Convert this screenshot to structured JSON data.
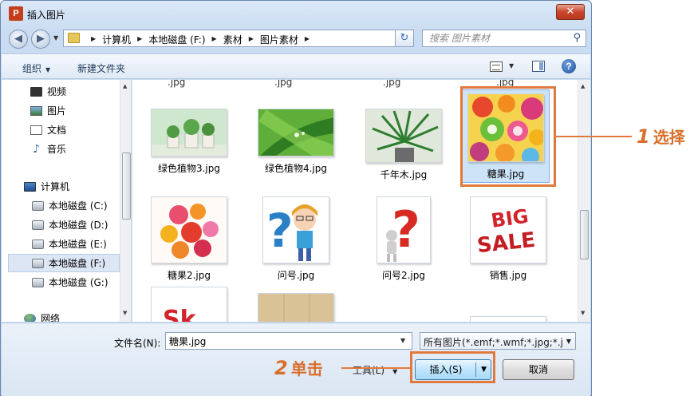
{
  "window": {
    "title": "插入图片",
    "app_icon": "P",
    "close_glyph": "✕"
  },
  "address": {
    "crumbs": [
      "计算机",
      "本地磁盘 (F:)",
      "素材",
      "图片素材"
    ],
    "search_placeholder": "搜索 图片素材"
  },
  "toolbar": {
    "organize_label": "组织",
    "new_folder_label": "新建文件夹"
  },
  "nav": {
    "items": [
      {
        "label": "视频",
        "icon": "video-icon"
      },
      {
        "label": "图片",
        "icon": "pictures-icon"
      },
      {
        "label": "文档",
        "icon": "documents-icon"
      },
      {
        "label": "音乐",
        "icon": "music-icon"
      },
      {
        "label": "计算机",
        "icon": "computer-icon"
      },
      {
        "label": "本地磁盘 (C:)",
        "icon": "drive-icon"
      },
      {
        "label": "本地磁盘 (D:)",
        "icon": "drive-icon"
      },
      {
        "label": "本地磁盘 (E:)",
        "icon": "drive-icon"
      },
      {
        "label": "本地磁盘 (F:)",
        "icon": "drive-icon",
        "selected": true
      },
      {
        "label": "本地磁盘 (G:)",
        "icon": "drive-icon"
      },
      {
        "label": "网络",
        "icon": "network-icon"
      }
    ]
  },
  "files": {
    "row1": [
      {
        "name": "绿色植物3.jpg"
      },
      {
        "name": "绿色植物4.jpg"
      },
      {
        "name": "千年木.jpg"
      },
      {
        "name": "糖果.jpg",
        "selected": true
      }
    ],
    "row2": [
      {
        "name": "糖果2.jpg"
      },
      {
        "name": "问号.jpg"
      },
      {
        "name": "问号2.jpg"
      },
      {
        "name": "销售.jpg"
      }
    ],
    "row3_partial": [
      {
        "name": "",
        "thumbnail_text": "Sk"
      }
    ],
    "cut_labels": [
      ".jpg",
      ".jpg",
      ".jpg",
      ".jpg"
    ]
  },
  "bottom": {
    "filename_label": "文件名(N):",
    "filename_value": "糖果.jpg",
    "filter_value": "所有图片(*.emf;*.wmf;*.jpg;*.j",
    "tools_label": "工具(L)",
    "insert_label": "插入(S)",
    "cancel_label": "取消"
  },
  "annotations": {
    "step1_num": "1",
    "step1_text": "选择",
    "step2_num": "2",
    "step2_text": "单击"
  },
  "colors": {
    "annotation": "#e07a3c",
    "selection": "#cce3f8"
  }
}
